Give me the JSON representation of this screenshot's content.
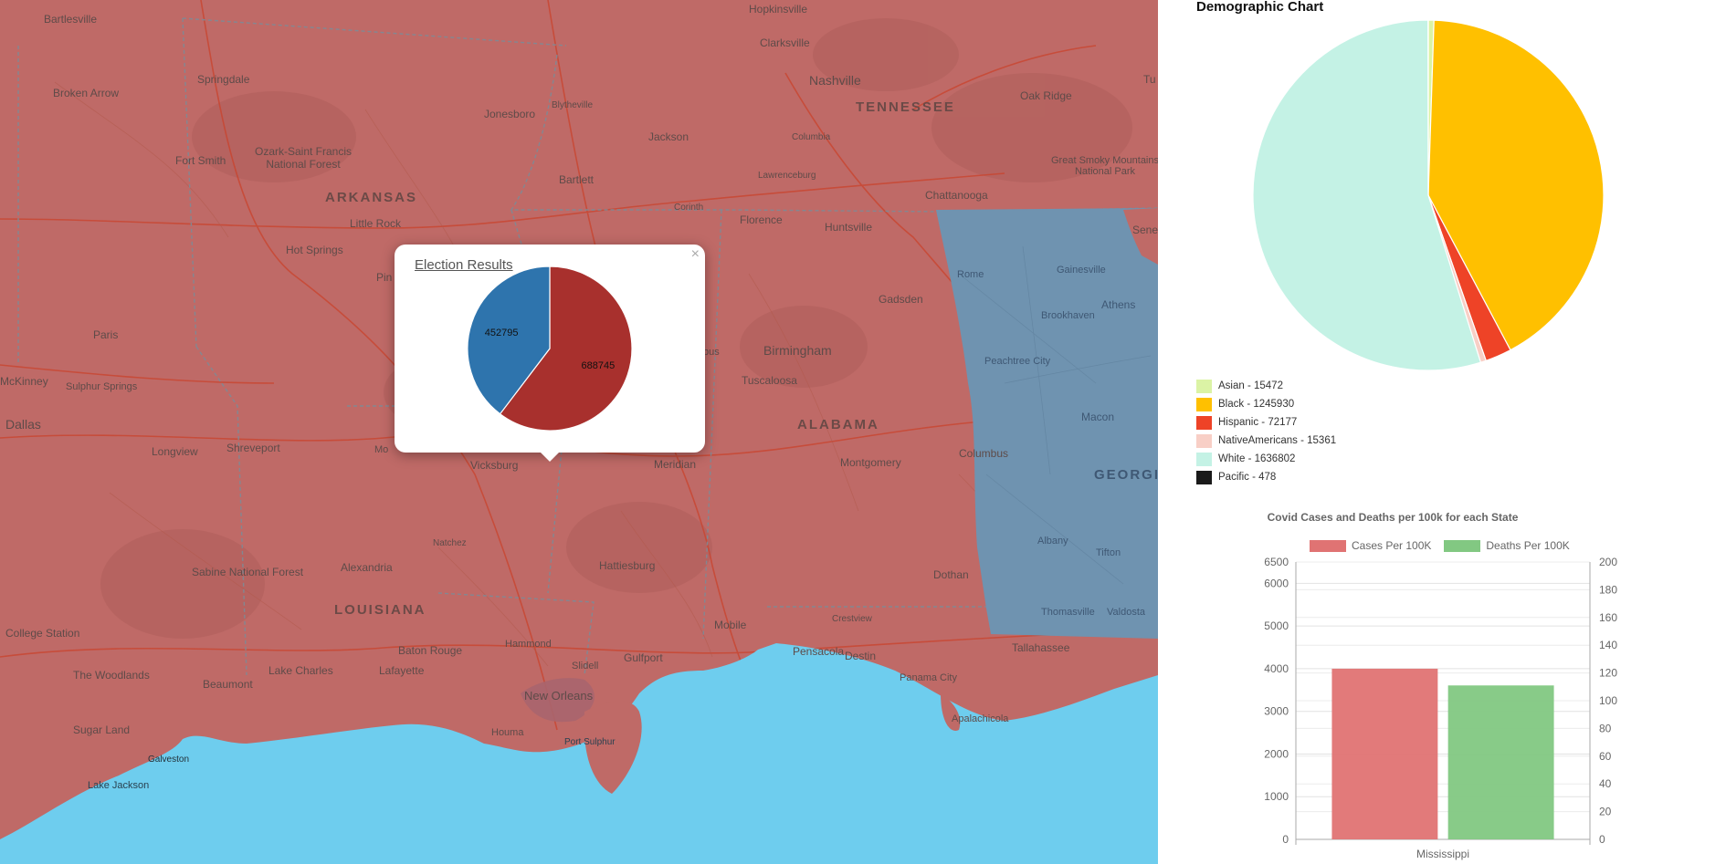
{
  "map": {
    "colors": {
      "republican": "#bf6a67",
      "democrat": "#6f93b0",
      "water": "#6ecdee"
    },
    "state_labels": [
      {
        "name": "ARKANSAS"
      },
      {
        "name": "TENNESSEE"
      },
      {
        "name": "ALABAMA"
      },
      {
        "name": "LOUISIANA"
      },
      {
        "name": "GEORGIA"
      }
    ],
    "city_labels": [
      "Bartlesville",
      "Hopkinsville",
      "Clarksville",
      "Broken Arrow",
      "Springdale",
      "Jonesboro",
      "Blytheville",
      "Nashville",
      "Oak Ridge",
      "Ozark-Saint Francis National Forest",
      "Fort Smith",
      "Jackson",
      "Columbia",
      "Great Smoky Mountains National Park",
      "Bartlett",
      "Lawrenceburg",
      "Corinth",
      "Chattanooga",
      "Little Rock",
      "Florence",
      "Huntsville",
      "Hot Springs",
      "Rome",
      "Gainesville",
      "Athens",
      "Gadsden",
      "Brookhaven",
      "Paris",
      "Birmingham",
      "Peachtree City",
      "McKinney",
      "Sulphur Springs",
      "Tuscaloosa",
      "Macon",
      "Dallas",
      "Longview",
      "Shreveport",
      "Vicksburg",
      "Meridian",
      "Montgomery",
      "Columbus",
      "Natchez",
      "Hattiesburg",
      "Albany",
      "Tifton",
      "Sabine National Forest",
      "Alexandria",
      "Dothan",
      "College Station",
      "Thomasville",
      "Valdosta",
      "Baton Rouge",
      "Hammond",
      "Mobile",
      "Crestview",
      "Tallahassee",
      "The Woodlands",
      "Lake Charles",
      "Lafayette",
      "Slidell",
      "Gulfport",
      "Pensacola",
      "Destin",
      "Panama City",
      "Beaumont",
      "New Orleans",
      "Apalachicola",
      "Sugar Land",
      "Houma",
      "Port Sulphur",
      "Galveston",
      "Lake Jackson",
      "Seneca",
      "Tu",
      "Pin",
      "Mo",
      "bus"
    ],
    "popup": {
      "title": "Election Results",
      "close": "×",
      "chart_data": {
        "type": "pie",
        "slices": [
          {
            "label": "688745",
            "value": 688745,
            "color": "#a8302d"
          },
          {
            "label": "452795",
            "value": 452795,
            "color": "#2e74ad"
          }
        ]
      }
    }
  },
  "panel": {
    "demographic": {
      "title": "Demographic Chart",
      "chart_data": {
        "type": "pie",
        "slices": [
          {
            "label": "Asian",
            "value": 15472,
            "color": "#dbf3a5",
            "legend": "Asian - 15472"
          },
          {
            "label": "Black",
            "value": 1245930,
            "color": "#ffc000",
            "legend": "Black - 1245930"
          },
          {
            "label": "Hispanic",
            "value": 72177,
            "color": "#ee4327",
            "legend": "Hispanic - 72177"
          },
          {
            "label": "NativeAmericans",
            "value": 15361,
            "color": "#f8cfc6",
            "legend": "NativeAmericans - 15361"
          },
          {
            "label": "White",
            "value": 1636802,
            "color": "#c4f2e5",
            "legend": "White - 1636802"
          },
          {
            "label": "Pacific",
            "value": 478,
            "color": "#1a1a1a",
            "legend": "Pacific - 478"
          }
        ]
      }
    },
    "covid": {
      "title": "Covid Cases and Deaths per 100k for each State",
      "chart_data": {
        "type": "bar",
        "categories": [
          "Mississippi"
        ],
        "series": [
          {
            "name": "Cases Per 100K",
            "values": [
              4000
            ],
            "color": "#e07373",
            "axis": "left"
          },
          {
            "name": "Deaths Per 100K",
            "values": [
              111
            ],
            "color": "#82c882",
            "axis": "right"
          }
        ],
        "y_left": {
          "min": 0,
          "max": 6500,
          "ticks": [
            "0",
            "1000",
            "2000",
            "3000",
            "4000",
            "5000",
            "6000",
            "6500"
          ]
        },
        "y_right": {
          "min": 0,
          "max": 200,
          "ticks": [
            "0",
            "20",
            "40",
            "60",
            "80",
            "100",
            "120",
            "140",
            "160",
            "180",
            "200"
          ]
        }
      }
    }
  }
}
